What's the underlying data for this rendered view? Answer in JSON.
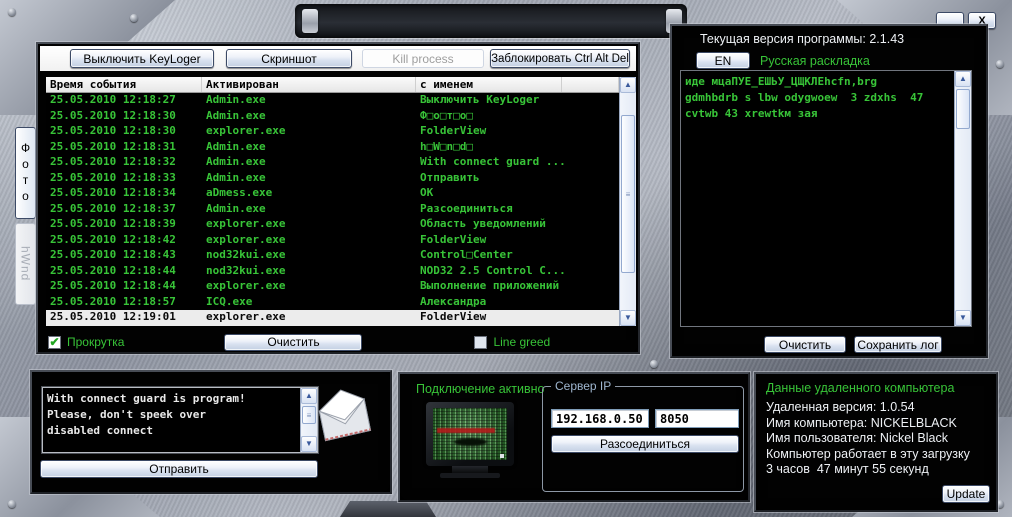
{
  "window": {
    "minimize_label": "_",
    "close_label": "X"
  },
  "side_buttons": {
    "photo_label": "Фото",
    "hwnd_label": "hWnd"
  },
  "toolbar": {
    "keylogger_off_label": "Выключить KeyLoger",
    "screenshot_label": "Скриншот",
    "kill_process_label": "Kill process",
    "block_ctrl_alt_del_label": "Заблокировать Ctrl Alt Del"
  },
  "log_table": {
    "columns": [
      "Время события",
      "Активирован",
      "с именем"
    ],
    "rows": [
      [
        "25.05.2010 12:18:27",
        "Admin.exe",
        "Выключить KeyLoger"
      ],
      [
        "25.05.2010 12:18:30",
        "Admin.exe",
        "Ф□о□т□о□"
      ],
      [
        "25.05.2010 12:18:30",
        "explorer.exe",
        "FolderView"
      ],
      [
        "25.05.2010 12:18:31",
        "Admin.exe",
        "h□W□n□d□"
      ],
      [
        "25.05.2010 12:18:32",
        "Admin.exe",
        "With connect guard ..."
      ],
      [
        "25.05.2010 12:18:33",
        "Admin.exe",
        "Отправить"
      ],
      [
        "25.05.2010 12:18:34",
        "aDmess.exe",
        "OK"
      ],
      [
        "25.05.2010 12:18:37",
        "Admin.exe",
        "Разсоединиться"
      ],
      [
        "25.05.2010 12:18:39",
        "explorer.exe",
        "Область уведомлений"
      ],
      [
        "25.05.2010 12:18:42",
        "explorer.exe",
        "FolderView"
      ],
      [
        "25.05.2010 12:18:43",
        "nod32kui.exe",
        "Control□Center"
      ],
      [
        "25.05.2010 12:18:44",
        "nod32kui.exe",
        "NOD32 2.5 Control C..."
      ],
      [
        "25.05.2010 12:18:44",
        "explorer.exe",
        "Выполнение приложений"
      ],
      [
        "25.05.2010 12:18:57",
        "ICQ.exe",
        "Александра"
      ],
      [
        "25.05.2010 12:19:01",
        "explorer.exe",
        "FolderView"
      ]
    ],
    "selected_row_index": 14
  },
  "log_controls": {
    "autoscroll_label": "Прокрутка",
    "autoscroll_checked": true,
    "clear_label": "Очистить",
    "line_greed_label": "Line greed",
    "line_greed_checked": false
  },
  "keylog_panel": {
    "version_label": "Текущая версия программы: 2.1.43",
    "layout_button_label": "EN",
    "layout_label": "Русская раскладка",
    "log_lines": [
      "иде мцаПУЕ_ЕШЬУ_ЦЩКЛЕhcfn,brg",
      "gdmhbdrb s lbw odygwoew  3 zdxhs  47",
      "cvtwb 43 xrewtkм зая"
    ],
    "clear_label": "Очистить",
    "save_label": "Сохранить лог"
  },
  "message_panel": {
    "message_lines": [
      "With connect guard is program!",
      "Please, don't speek over",
      "disabled connect"
    ],
    "send_label": "Отправить"
  },
  "connection_panel": {
    "status_label": "Подключение активно",
    "group_label": "Сервер IP",
    "ip_value": "192.168.0.50",
    "port_value": "8050",
    "disconnect_label": "Разсоединиться"
  },
  "remote_info": {
    "title": "Данные удаленного компьютера",
    "lines": [
      "Удаленная версия: 1.0.54",
      "Имя компьютера: NICKELBLACK",
      "Имя пользователя: Nickel Black",
      "Компьютер работает в эту загрузку",
      "3 часов  47 минут 55 секунд"
    ],
    "update_label": "Update"
  },
  "colors": {
    "terminal_green": "#38c438",
    "group_label_blue": "#9fb6cf"
  }
}
